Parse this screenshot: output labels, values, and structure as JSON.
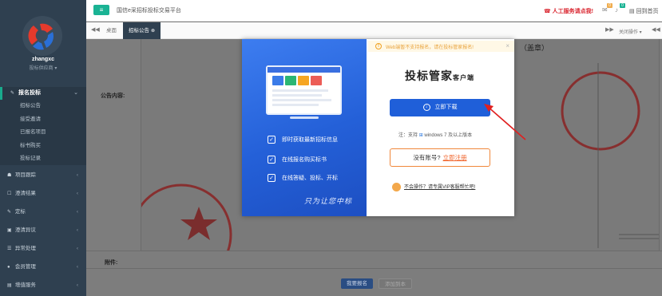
{
  "sidebar": {
    "user_name": "zhangxc",
    "user_role": "投标供应商 ▾",
    "group": {
      "label": "报名投标",
      "items": [
        "招标公告",
        "接受邀请",
        "已报名项目",
        "标书购买",
        "投标记录"
      ]
    },
    "menu": [
      {
        "label": "项目跟踪",
        "icon": "☗"
      },
      {
        "label": "澄清结果",
        "icon": "☐"
      },
      {
        "label": "定标",
        "icon": "✎"
      },
      {
        "label": "澄清异议",
        "icon": "▣"
      },
      {
        "label": "异常处理",
        "icon": "☰"
      },
      {
        "label": "会员管理",
        "icon": "●"
      },
      {
        "label": "增值服务",
        "icon": "▤"
      }
    ]
  },
  "topbar": {
    "platform": "国信e采招标投标交易平台",
    "service": "人工服务请点我!",
    "badge_a": "0",
    "badge_b": "0",
    "home": "回到首页"
  },
  "tabs": {
    "items": [
      {
        "label": "桌面"
      },
      {
        "label": "招标公告"
      }
    ],
    "close_ops": "关闭操作"
  },
  "content": {
    "label_content": "公告内容:",
    "label_attach": "附件:",
    "stamp": "（盖章）",
    "btn_signup": "我要报名",
    "btn_add": "添加到本"
  },
  "modal": {
    "warning": "Web端暂不支持报名，请在投标管家报名!",
    "title": "投标管家",
    "title_suffix": "客户端",
    "download": "立即下载",
    "support": "注：支持",
    "support_os": "windows 7 及以上版本",
    "have_account": "没有账号?",
    "register": "立即注册",
    "help": "不会操作？请专属VIP客服帮忙吧!",
    "features": [
      "即时获取最新招标信息",
      "在线报名购买标书",
      "在线答疑、投标、开标"
    ],
    "slogan": "只为让您中标"
  }
}
